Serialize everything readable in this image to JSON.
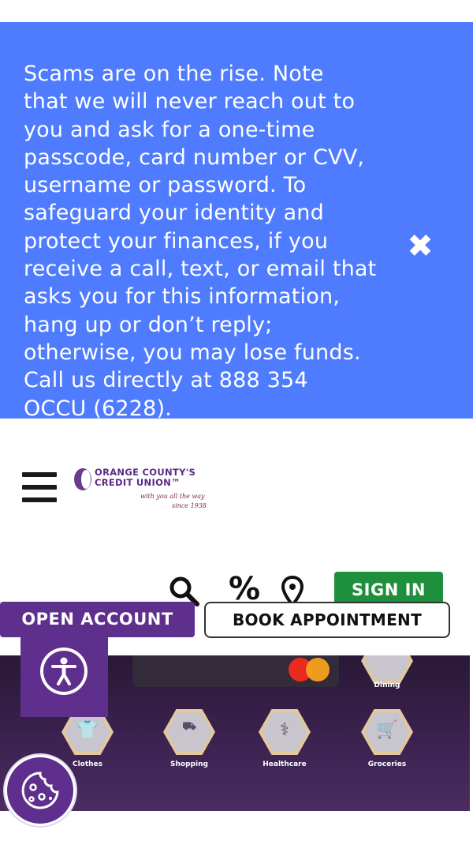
{
  "alert": {
    "message_lines": [
      "Scams are on the rise. Note",
      "that we will never reach out to",
      "you and ask for a one-time",
      "passcode, card number or CVV,",
      "username or password. To",
      "safeguard your identity and",
      "protect your finances, if you",
      "receive a call, text, or email that",
      "asks you for this information,",
      "hang up or don’t reply;",
      "otherwise, you may lose funds.",
      "Call us directly at 888 354",
      "OCCU (6228)."
    ],
    "close_glyph": "✖"
  },
  "logo": {
    "line1": "ORANGE COUNTY'S",
    "line2": "CREDIT UNION™",
    "tagline1": "with you all the way",
    "tagline2": "since 1938"
  },
  "header": {
    "signin_label": "SIGN IN",
    "open_account_label": "OPEN ACCOUNT",
    "book_appointment_label": "BOOK APPOINTMENT",
    "rates_glyph": "%"
  },
  "banner": {
    "labels": {
      "dining": "Dining",
      "clothes": "Clothes",
      "shopping": "Shopping",
      "healthcare": "Healthcare",
      "groceries": "Groceries"
    },
    "colors": {
      "mastercard_red": "#eb2a1e",
      "mastercard_yellow": "#f7a21b"
    }
  },
  "colors": {
    "alert_bg": "#4f7cff",
    "brand_purple": "#5e2f8c",
    "signin_green": "#1e8f3c"
  },
  "icons": {
    "menu": "hamburger-menu-icon",
    "search": "search-icon",
    "rates": "percent-icon",
    "location": "location-pin-icon",
    "accessibility": "accessibility-icon",
    "cookie": "cookie-icon",
    "close": "close-icon"
  }
}
